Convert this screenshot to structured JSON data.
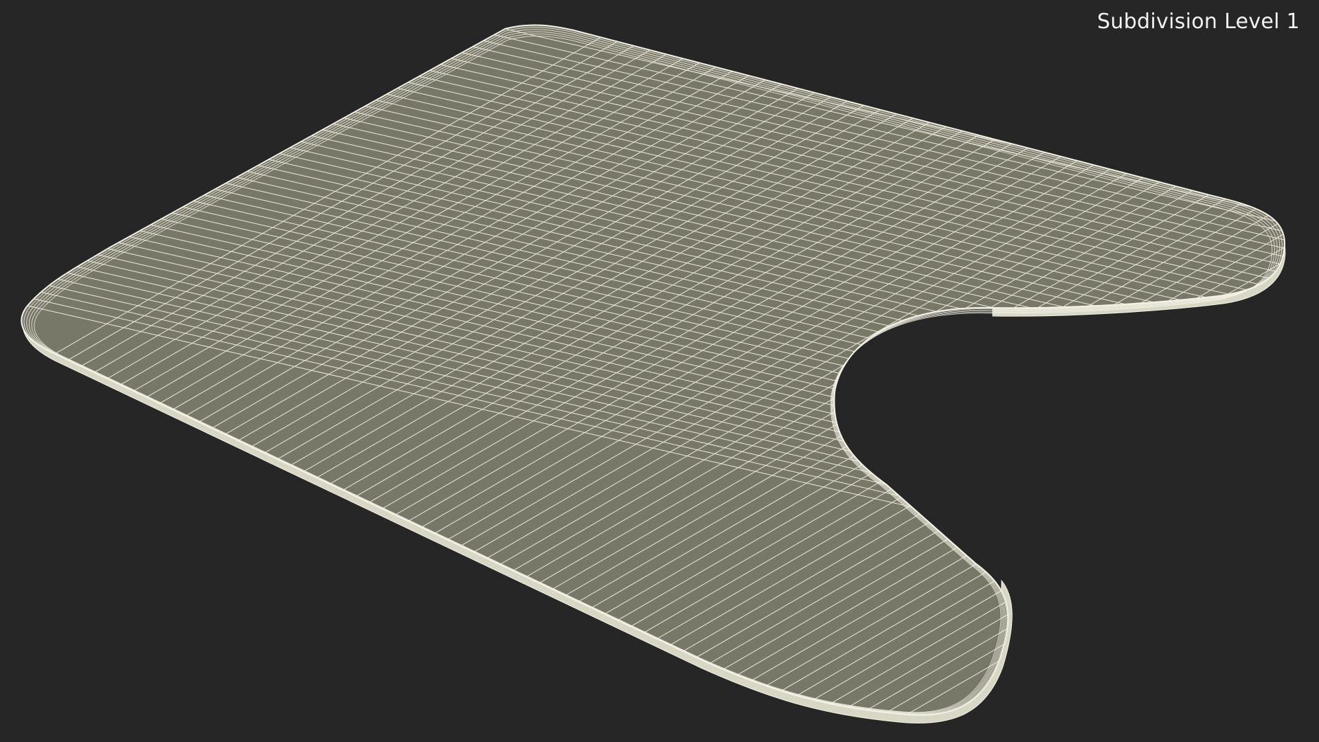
{
  "viewport": {
    "overlay_label": "Subdivision Level 1",
    "background_color": "#262626",
    "mesh_fill_color": "#7a7a6e",
    "wireframe_color": "#f2f0e0",
    "subject": "u-shaped-mat-wireframe"
  }
}
